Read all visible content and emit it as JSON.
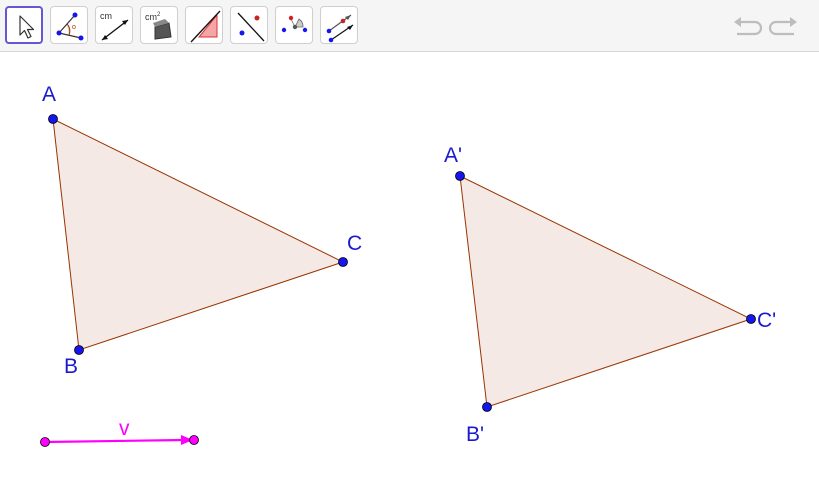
{
  "toolbar": {
    "tools": [
      {
        "name": "move",
        "icon": "pointer-arrow-icon",
        "active": true
      },
      {
        "name": "angle",
        "icon": "angle-icon",
        "active": false
      },
      {
        "name": "distance",
        "icon": "distance-icon",
        "label": "cm",
        "active": false
      },
      {
        "name": "area",
        "icon": "area-icon",
        "label": "cm",
        "label_sup": "2",
        "active": false
      },
      {
        "name": "slope",
        "icon": "slope-icon",
        "active": false
      },
      {
        "name": "reflect-about-line",
        "icon": "reflect-line-icon",
        "active": false
      },
      {
        "name": "rotate-around-point",
        "icon": "rotate-point-icon",
        "active": false
      },
      {
        "name": "translate-by-vector",
        "icon": "translate-vector-icon",
        "active": false
      }
    ],
    "undo_icon": "undo-icon",
    "redo_icon": "redo-icon"
  },
  "colors": {
    "point": "#1515ee",
    "label": "#1a1acc",
    "edge": "#993300",
    "fill": "#f4e9e4",
    "vector": "#ff00ff",
    "active_tool": "#6557d2"
  },
  "points": {
    "A": "A",
    "B": "B",
    "C": "C",
    "A_prime": "A'",
    "B_prime": "B'",
    "C_prime": "C'"
  },
  "vector": {
    "label": "v"
  }
}
